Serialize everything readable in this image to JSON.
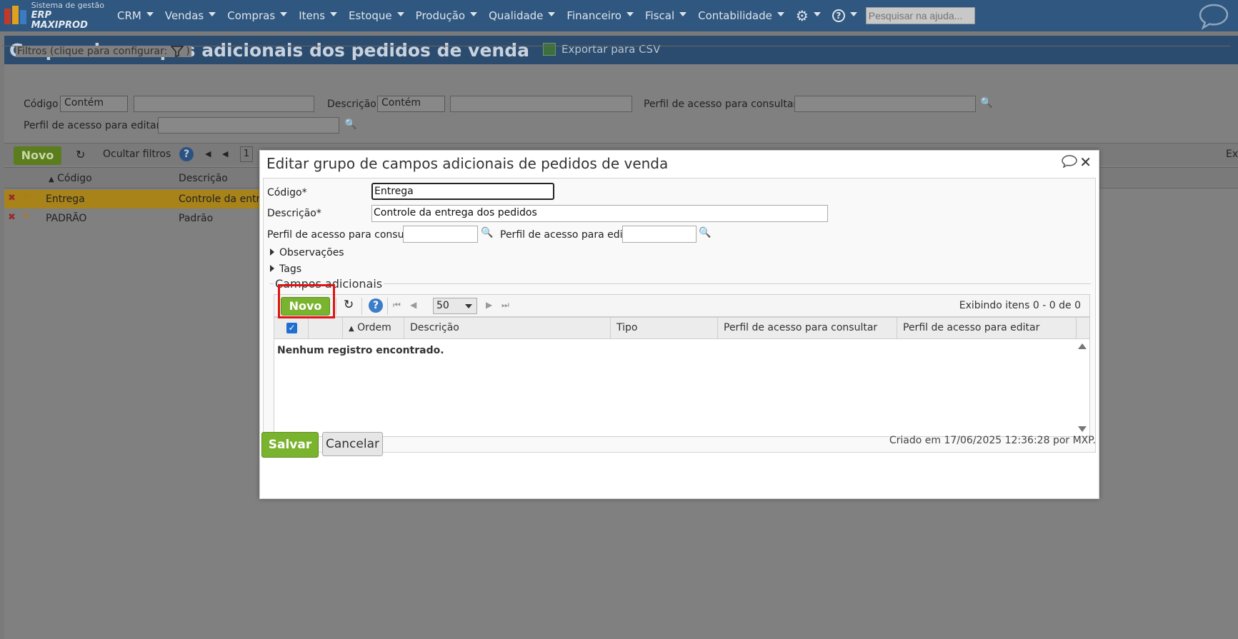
{
  "topnav": {
    "logo_line1": "Sistema de gestão",
    "logo_line2": "ERP MAXIPROD",
    "menu": [
      {
        "label": "CRM"
      },
      {
        "label": "Vendas"
      },
      {
        "label": "Compras"
      },
      {
        "label": "Itens"
      },
      {
        "label": "Estoque"
      },
      {
        "label": "Produção"
      },
      {
        "label": "Qualidade"
      },
      {
        "label": "Financeiro"
      },
      {
        "label": "Fiscal"
      },
      {
        "label": "Contabilidade"
      }
    ],
    "help_search_placeholder": "Pesquisar na ajuda..."
  },
  "page": {
    "title": "Grupos de campos adicionais dos pedidos de venda",
    "export_label": "Exportar para CSV",
    "filters": {
      "legend": "Filtros (clique para configurar:",
      "legend_end": ")",
      "codigo_label": "Código",
      "codigo_op": "Contém",
      "descricao_label": "Descrição",
      "descricao_op": "Contém",
      "perfil_consultar_label": "Perfil de acesso para consultar",
      "perfil_editar_label": "Perfil de acesso para editar"
    },
    "toolbar": {
      "novo": "Novo",
      "ocultar_filtros": "Ocultar filtros",
      "page_number": "1",
      "right_text": "Ex"
    },
    "grid": {
      "headers": [
        "Código",
        "Descrição"
      ],
      "rows": [
        {
          "codigo": "Entrega",
          "descricao": "Controle da entr"
        },
        {
          "codigo": "PADRÃO",
          "descricao": "Padrão"
        }
      ]
    }
  },
  "modal": {
    "title": "Editar grupo de campos adicionais de pedidos de venda",
    "codigo_label": "Código*",
    "codigo_value": "Entrega",
    "descricao_label": "Descrição*",
    "descricao_value": "Controle da entrega dos pedidos",
    "perfil_consultar_label": "Perfil de acesso para consultar",
    "perfil_editar_label": "Perfil de acesso para editar",
    "observacoes": "Observações",
    "tags": "Tags",
    "section_title": "Campos adicionais",
    "sub_toolbar": {
      "novo": "Novo",
      "page_size": "50",
      "showing": "Exibindo itens 0 - 0 de 0"
    },
    "sub_grid": {
      "headers": [
        "Ordem",
        "Descrição",
        "Tipo",
        "Perfil de acesso para consultar",
        "Perfil de acesso para editar"
      ],
      "empty": "Nenhum registro encontrado."
    },
    "salvar": "Salvar",
    "cancelar": "Cancelar",
    "created": "Criado em 17/06/2025 12:36:28 por MXP."
  }
}
